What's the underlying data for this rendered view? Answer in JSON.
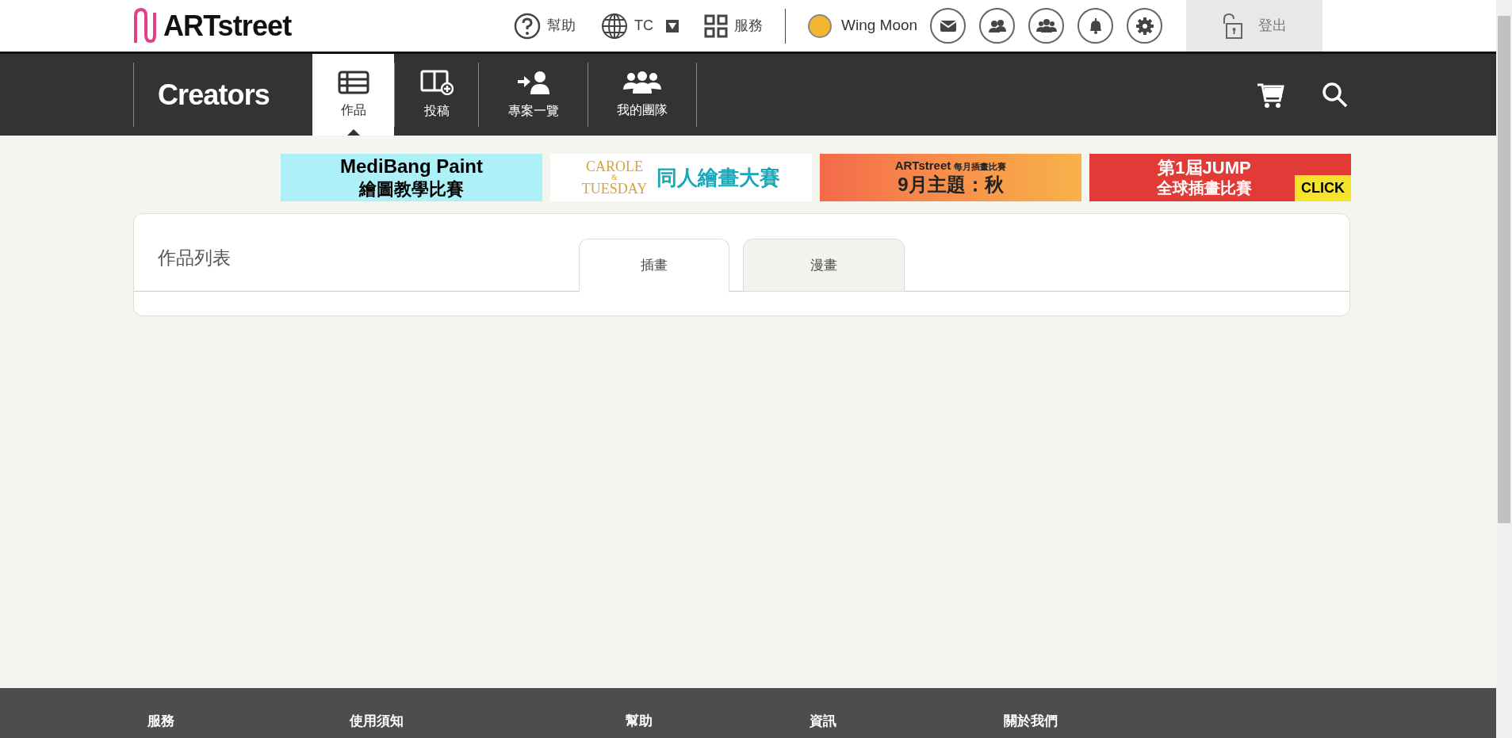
{
  "header": {
    "logo": "ARTstreet",
    "links": [
      {
        "kind": "help",
        "label": "幫助"
      },
      {
        "kind": "language",
        "label": "TC"
      },
      {
        "kind": "services",
        "label": "服務"
      }
    ],
    "user": {
      "name": "Wing Moon"
    },
    "logout": "登出"
  },
  "nav": {
    "brand": "Creators",
    "tabs": [
      {
        "kind": "works",
        "label": "作品",
        "selected": true
      },
      {
        "kind": "post",
        "label": "投稿",
        "selected": false
      },
      {
        "kind": "projects",
        "label": "專案一覽",
        "selected": false
      },
      {
        "kind": "team",
        "label": "我的團隊",
        "selected": false
      }
    ]
  },
  "banners": [
    {
      "kind": "medibang",
      "lines": [
        "MediBang Paint",
        "繪圖教學比賽"
      ]
    },
    {
      "kind": "carole",
      "lines": [
        "CAROLE",
        "&",
        "TUESDAY",
        "同人繪畫大賽"
      ]
    },
    {
      "kind": "monthly",
      "lines": [
        "ARTstreet",
        "每月插畫比賽",
        "9月主題：秋"
      ]
    },
    {
      "kind": "jump",
      "lines": [
        "第1屆JUMP",
        "全球插畫比賽",
        "CLICK"
      ]
    }
  ],
  "works_panel": {
    "title": "作品列表",
    "tabs": [
      {
        "label": "插畫",
        "selected": true
      },
      {
        "label": "漫畫",
        "selected": false
      }
    ]
  },
  "footer": {
    "columns": [
      "服務",
      "使用須知",
      "幫助",
      "資訊",
      "關於我們"
    ]
  }
}
